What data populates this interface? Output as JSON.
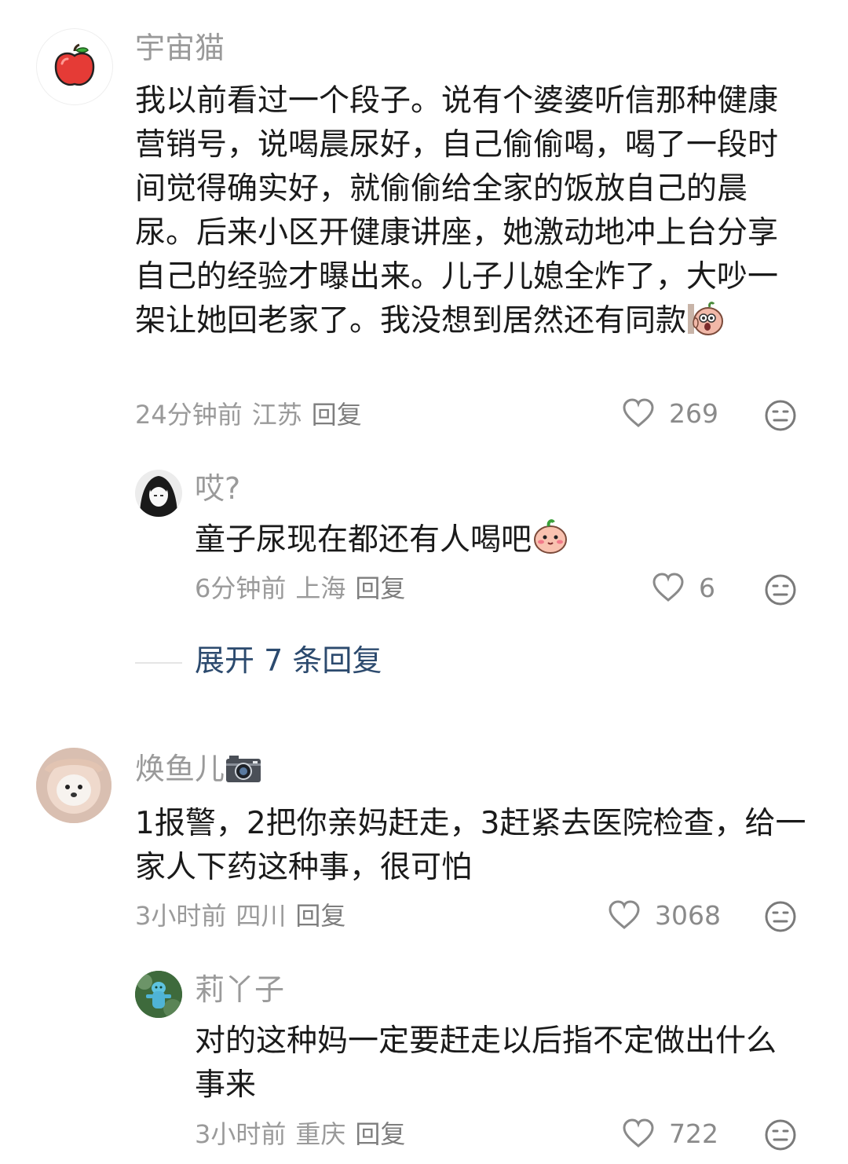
{
  "comments": [
    {
      "username": "宇宙猫",
      "avatar_icon": "apple-icon",
      "text": "我以前看过一个段子。说有个婆婆听信那种健康营销号，说喝晨尿好，自己偷偷喝，喝了一段时间觉得确实好，就偷偷给全家的饭放自己的晨尿。后来小区开健康讲座，她激动地冲上台分享自己的经验才曝出来。儿子儿媳全炸了，大吵一架让她回老家了。我没想到居然还有同款",
      "time": "24分钟前",
      "location": "江苏",
      "reply_label": "回复",
      "likes": "269",
      "reply": {
        "username": "哎?",
        "avatar_icon": "anime-avatar-icon",
        "text": "童子尿现在都还有人喝吧",
        "time": "6分钟前",
        "location": "上海",
        "reply_label": "回复",
        "likes": "6"
      },
      "expand_label": "展开 7 条回复"
    },
    {
      "username": "焕鱼儿",
      "avatar_icon": "puppy-avatar-icon",
      "text": "1报警，2把你亲妈赶走，3赶紧去医院检查，给一家人下药这种事，很可怕",
      "time": "3小时前",
      "location": "四川",
      "reply_label": "回复",
      "likes": "3068",
      "reply": {
        "username": "莉丫子",
        "avatar_icon": "blue-figure-avatar-icon",
        "text": "对的这种妈一定要赶走以后指不定做出什么事来",
        "time": "3小时前",
        "location": "重庆",
        "reply_label": "回复",
        "likes": "722"
      }
    }
  ],
  "colors": {
    "text": "#1a1a1a",
    "meta": "#9a9a9a",
    "link": "#2c4a6e"
  }
}
